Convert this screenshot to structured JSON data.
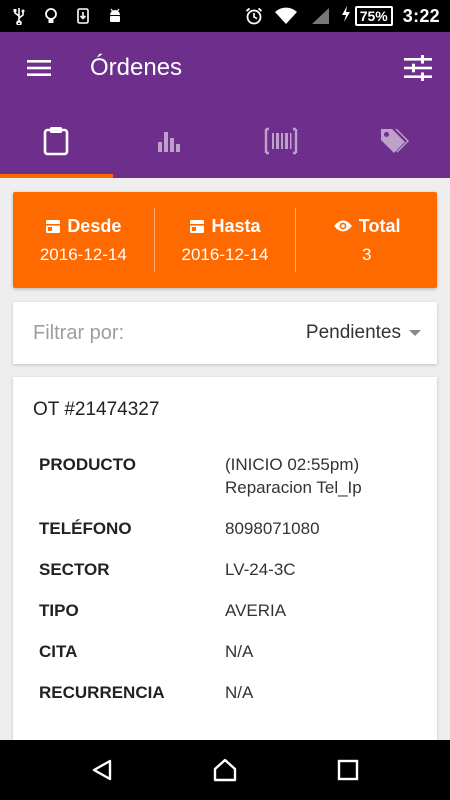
{
  "status_bar": {
    "left_icons": [
      "usb-icon",
      "lightbulb-icon",
      "download-icon",
      "android-icon"
    ],
    "right_icons": [
      "alarm-icon",
      "wifi-icon",
      "signal-icon",
      "charging-icon"
    ],
    "battery": "75%",
    "time": "3:22"
  },
  "app_bar": {
    "title": "Órdenes",
    "color": "#6d2f8b",
    "tabs": [
      {
        "icon": "clipboard-icon",
        "active": true
      },
      {
        "icon": "bar-chart-icon",
        "active": false
      },
      {
        "icon": "barcode-icon",
        "active": false
      },
      {
        "icon": "tags-icon",
        "active": false
      }
    ]
  },
  "summary": {
    "color": "#ff6a00",
    "from_label": "Desde",
    "from_value": "2016-12-14",
    "to_label": "Hasta",
    "to_value": "2016-12-14",
    "total_label": "Total",
    "total_value": "3"
  },
  "filter": {
    "label": "Filtrar por:",
    "selected": "Pendientes"
  },
  "order": {
    "id": "OT #21474327",
    "fields": [
      {
        "label": "PRODUCTO",
        "value": "(INICIO 02:55pm)\nReparacion Tel_Ip"
      },
      {
        "label": "TELÉFONO",
        "value": "8098071080"
      },
      {
        "label": "SECTOR",
        "value": "LV-24-3C"
      },
      {
        "label": "TIPO",
        "value": "AVERIA"
      },
      {
        "label": "CITA",
        "value": "N/A"
      },
      {
        "label": "RECURRENCIA",
        "value": "N/A"
      }
    ]
  },
  "nav_bar": [
    "back-icon",
    "home-icon",
    "recents-icon"
  ]
}
